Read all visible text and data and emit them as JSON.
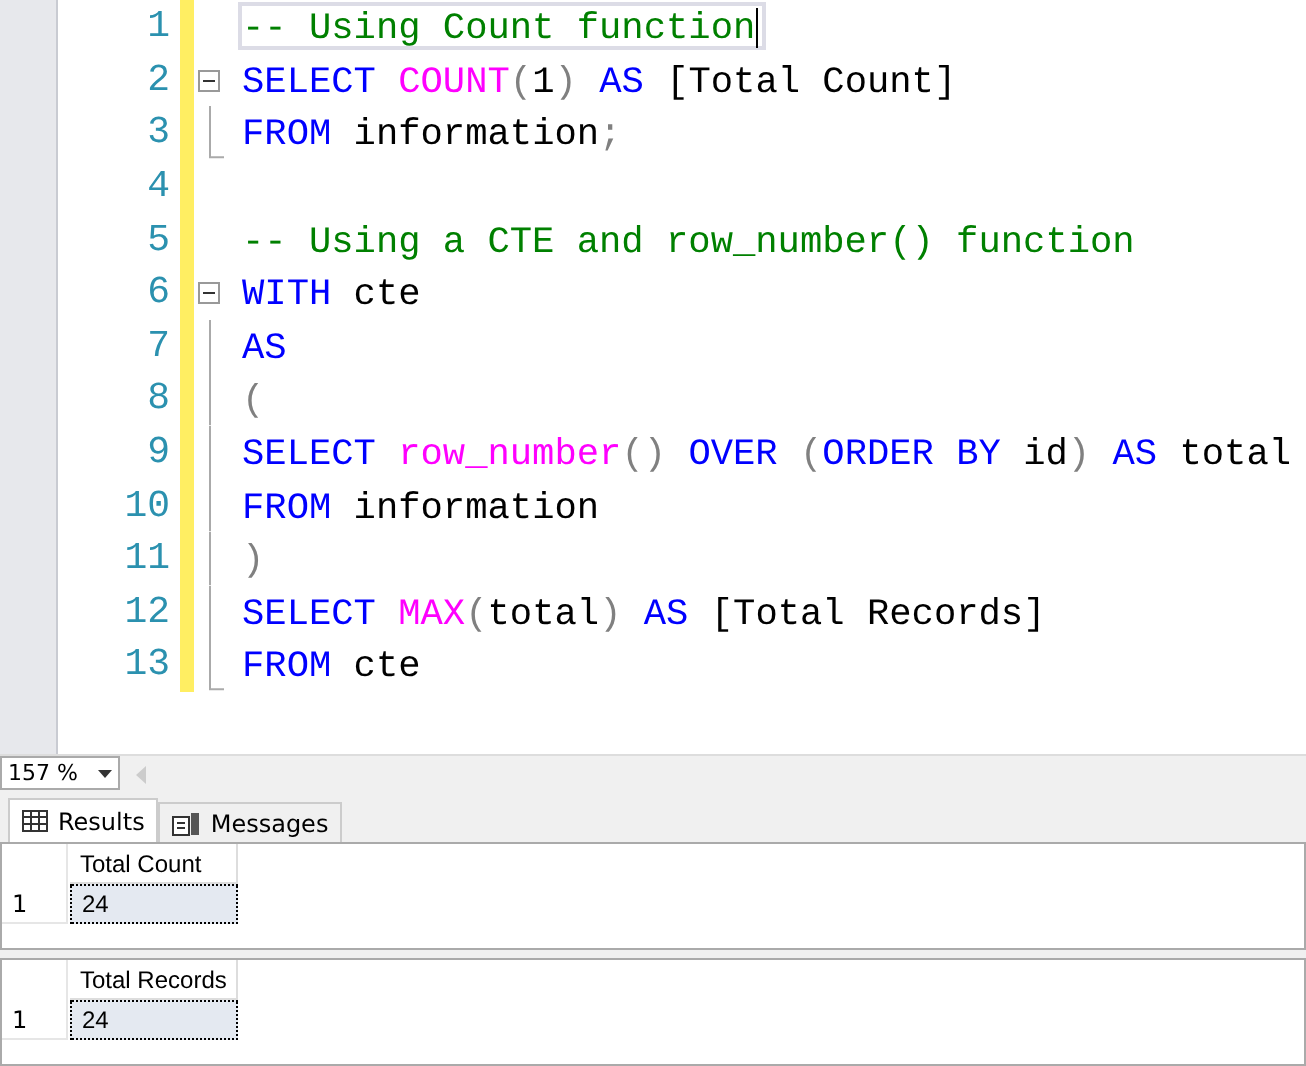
{
  "editor": {
    "lines": [
      {
        "number": "1",
        "fold_start": false,
        "fold_end": false,
        "current": true,
        "tokens": [
          {
            "kind": "comment",
            "text": "-- Using Count function"
          }
        ]
      },
      {
        "number": "2",
        "fold_start": true,
        "fold_end": false,
        "current": false,
        "tokens": [
          {
            "kind": "keyword",
            "text": "SELECT"
          },
          {
            "kind": "function",
            "text": " COUNT"
          },
          {
            "kind": "operator",
            "text": "("
          },
          {
            "kind": "plain",
            "text": "1"
          },
          {
            "kind": "operator",
            "text": ")"
          },
          {
            "kind": "keyword",
            "text": " AS"
          },
          {
            "kind": "plain",
            "text": " [Total Count]"
          }
        ]
      },
      {
        "number": "3",
        "fold_start": false,
        "fold_end": true,
        "current": false,
        "tokens": [
          {
            "kind": "keyword",
            "text": "FROM"
          },
          {
            "kind": "plain",
            "text": " information"
          },
          {
            "kind": "operator",
            "text": ";"
          }
        ]
      },
      {
        "number": "4",
        "fold_start": false,
        "fold_end": false,
        "current": false
      },
      {
        "number": "5",
        "fold_start": false,
        "fold_end": false,
        "current": false,
        "tokens": [
          {
            "kind": "comment",
            "text": "-- Using a CTE and row_number() function"
          }
        ]
      },
      {
        "number": "6",
        "fold_start": true,
        "fold_end": false,
        "current": false,
        "tokens": [
          {
            "kind": "keyword",
            "text": "WITH"
          },
          {
            "kind": "plain",
            "text": " cte"
          }
        ]
      },
      {
        "number": "7",
        "fold_start": false,
        "fold_end": false,
        "current": false,
        "tokens": [
          {
            "kind": "keyword",
            "text": "AS"
          }
        ]
      },
      {
        "number": "8",
        "fold_start": false,
        "fold_end": false,
        "current": false,
        "tokens": [
          {
            "kind": "operator",
            "text": "("
          }
        ]
      },
      {
        "number": "9",
        "fold_start": false,
        "fold_end": false,
        "current": false,
        "tokens": [
          {
            "kind": "keyword",
            "text": "SELECT"
          },
          {
            "kind": "function",
            "text": " row_number"
          },
          {
            "kind": "operator",
            "text": "()"
          },
          {
            "kind": "keyword",
            "text": " OVER"
          },
          {
            "kind": "operator",
            "text": " ("
          },
          {
            "kind": "keyword",
            "text": "ORDER BY"
          },
          {
            "kind": "plain",
            "text": " id"
          },
          {
            "kind": "operator",
            "text": ")"
          },
          {
            "kind": "keyword",
            "text": " AS"
          },
          {
            "kind": "plain",
            "text": " total"
          }
        ]
      },
      {
        "number": "10",
        "fold_start": false,
        "fold_end": false,
        "current": false,
        "tokens": [
          {
            "kind": "keyword",
            "text": "FROM"
          },
          {
            "kind": "plain",
            "text": " information"
          }
        ]
      },
      {
        "number": "11",
        "fold_start": false,
        "fold_end": false,
        "current": false,
        "tokens": [
          {
            "kind": "operator",
            "text": ")"
          }
        ]
      },
      {
        "number": "12",
        "fold_start": false,
        "fold_end": false,
        "current": false,
        "tokens": [
          {
            "kind": "keyword",
            "text": "SELECT"
          },
          {
            "kind": "function",
            "text": " MAX"
          },
          {
            "kind": "operator",
            "text": "("
          },
          {
            "kind": "plain",
            "text": "total"
          },
          {
            "kind": "operator",
            "text": ")"
          },
          {
            "kind": "keyword",
            "text": " AS"
          },
          {
            "kind": "plain",
            "text": " [Total Records]"
          }
        ]
      },
      {
        "number": "13",
        "fold_start": false,
        "fold_end": true,
        "current": false,
        "tokens": [
          {
            "kind": "keyword",
            "text": "FROM"
          },
          {
            "kind": "plain",
            "text": " cte"
          }
        ]
      }
    ]
  },
  "zoom": {
    "value": "157 %"
  },
  "tabs": [
    {
      "label": "Results",
      "kind": "grid",
      "selected": true
    },
    {
      "label": "Messages",
      "kind": "messages",
      "selected": false
    }
  ],
  "results": [
    {
      "columns": [
        "Total Count"
      ],
      "rows": [
        {
          "number": "1",
          "cells": [
            {
              "text": "24",
              "selected": true
            }
          ]
        }
      ]
    },
    {
      "columns": [
        "Total Records"
      ],
      "rows": [
        {
          "number": "1",
          "cells": [
            {
              "text": "24",
              "selected": true
            }
          ]
        }
      ]
    }
  ]
}
